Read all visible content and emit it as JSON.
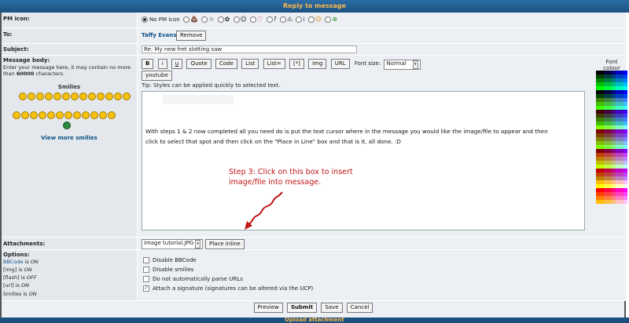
{
  "header": {
    "title": "Reply to message"
  },
  "pm_icon": {
    "label": "PM icon:",
    "no_icon_label": "No PM icon",
    "icons": [
      "💩",
      "☆",
      "✿",
      "☺",
      "♡",
      "?",
      "⚠",
      "i",
      "☹",
      "⊕"
    ]
  },
  "to": {
    "label": "To:",
    "recipient": "Taffy Evans",
    "remove_label": "Remove"
  },
  "subject": {
    "label": "Subject:",
    "value": "Re: My new fret slotting saw"
  },
  "body": {
    "label": "Message body:",
    "help1": "Enter your message here, it may contain no more",
    "help2a": "than ",
    "help2b": "60000",
    "help2c": " characters.",
    "smilies_title": "Smilies",
    "view_more": "View more smilies",
    "toolbar": [
      "B",
      "i",
      "u",
      "Quote",
      "Code",
      "List",
      "List=",
      "[*]",
      "Img",
      "URL"
    ],
    "font_size_label": "Font size:",
    "font_size_value": "Normal",
    "youtube_label": "youtube",
    "tip": "Tip: Styles can be applied quickly to selected text.",
    "message_line1": "With steps 1 & 2 now completed all you need do is put the text cursor where in the message you would like the image/file to appear and then",
    "message_line2": "click to select that spot and then click on the \"Place in Line\" box and that is it, all done.  :D",
    "font_colour_label1": "Font",
    "font_colour_label2": "colour"
  },
  "annotation": {
    "line1": "Step 3: Click on this box to insert",
    "line2": "image/file into message.",
    "color": "#c01515"
  },
  "attachments": {
    "label": "Attachments:",
    "selected_file": "image tutorial.JPG",
    "place_inline_label": "Place inline"
  },
  "options": {
    "label": "Options:",
    "status": [
      {
        "name": "BBCode",
        "state": "ON"
      },
      {
        "name": "[img]",
        "state": "ON"
      },
      {
        "name": "[flash]",
        "state": "OFF"
      },
      {
        "name": "[url]",
        "state": "ON"
      },
      {
        "name": "Smilies",
        "state": "ON"
      }
    ],
    "is_word": "is",
    "checkboxes": [
      {
        "label": "Disable BBCode",
        "checked": false
      },
      {
        "label": "Disable smilies",
        "checked": false
      },
      {
        "label": "Do not automatically parse URLs",
        "checked": false
      },
      {
        "label": "Attach a signature (signatures can be altered via the UCP)",
        "checked": true
      }
    ]
  },
  "buttons": {
    "preview": "Preview",
    "submit": "Submit",
    "save": "Save",
    "cancel": "Cancel"
  },
  "footer_tab": "Upload attachment",
  "colors": {
    "header_bg": "#1a4f7e",
    "header_text": "#ffb94a",
    "link": "#105289",
    "panel": "#ECEFF3"
  }
}
